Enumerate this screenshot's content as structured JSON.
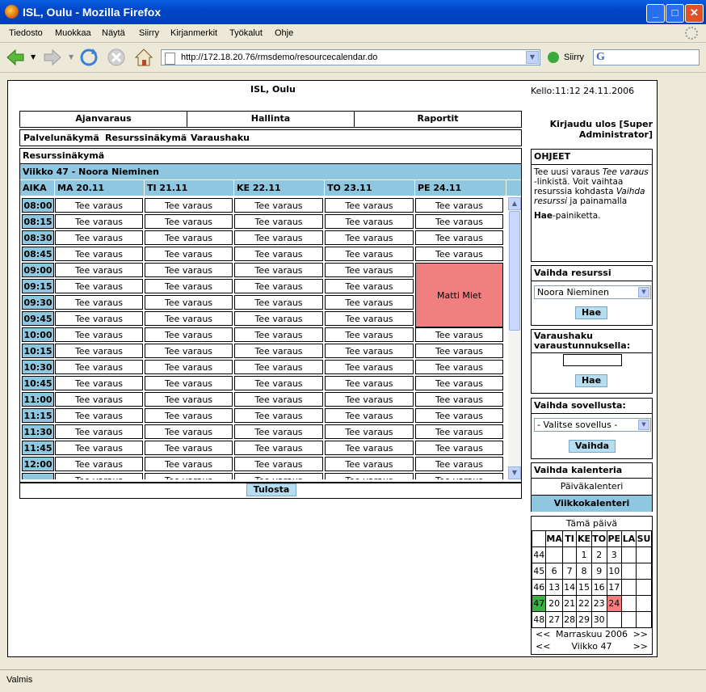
{
  "window": {
    "title": "ISL, Oulu - Mozilla Firefox"
  },
  "menu": [
    "Tiedosto",
    "Muokkaa",
    "Näytä",
    "Siirry",
    "Kirjanmerkit",
    "Työkalut",
    "Ohje"
  ],
  "toolbar": {
    "url": "http://172.18.20.76/rmsdemo/resourcecalendar.do",
    "go_label": "Siirry"
  },
  "header": {
    "org": "ISL, Oulu",
    "clock": "Kello:11:12 24.11.2006"
  },
  "main_menu": [
    "Ajanvaraus",
    "Hallinta",
    "Raportit"
  ],
  "sub_menu": [
    "Palvelunäkymä",
    "Resurssinäkymä",
    "Varaushaku"
  ],
  "calendar": {
    "section_title": "Resurssinäkymä",
    "week_title": "Viikko 47 - Noora Nieminen",
    "time_header": "AIKA",
    "days": [
      "MA 20.11",
      "TI 21.11",
      "KE 22.11",
      "TO 23.11",
      "PE 24.11"
    ],
    "times": [
      "08:00",
      "08:15",
      "08:30",
      "08:45",
      "09:00",
      "09:15",
      "09:30",
      "09:45",
      "10:00",
      "10:15",
      "10:30",
      "10:45",
      "11:00",
      "11:15",
      "11:30",
      "11:45",
      "12:00"
    ],
    "slot_label": "Tee varaus",
    "booking": {
      "label": "Matti Miet",
      "day": "PE 24.11",
      "start": "09:00",
      "end": "10:00"
    },
    "print_label": "Tulosta"
  },
  "sidebar": {
    "logout": "Kirjaudu ulos [Super Administrator]",
    "help_title": "OHJEET",
    "help_text": {
      "p1": "Tee uusi varaus ",
      "p1_em": "Tee varaus",
      "p2": " -linkistä. Voit vaihtaa resurssia kohdasta ",
      "p2_em": "Vaihda resurssi",
      "p3": " ja painamalla",
      "p4_bold": "Hae",
      "p4": "-painiketta."
    },
    "resource": {
      "title": "Vaihda resurssi",
      "selected": "Noora Nieminen",
      "button": "Hae"
    },
    "search": {
      "title": "Varaushaku varaustunnuksella:",
      "value": "",
      "button": "Hae"
    },
    "app": {
      "title": "Vaihda sovellusta:",
      "selected": "- Valitse sovellus -",
      "button": "Vaihda"
    },
    "calendar_switch": {
      "title": "Vaihda kalenteria",
      "day": "Päiväkalenteri",
      "week": "Viikkokalenteri"
    },
    "mini_calendar": {
      "today_label": "Tämä päivä",
      "weekdays": [
        "MA",
        "TI",
        "KE",
        "TO",
        "PE",
        "LA",
        "SU"
      ],
      "weeks": [
        {
          "wk": "44",
          "days": [
            "",
            "",
            "1",
            "2",
            "3",
            "",
            ""
          ]
        },
        {
          "wk": "45",
          "days": [
            "6",
            "7",
            "8",
            "9",
            "10",
            "",
            ""
          ]
        },
        {
          "wk": "46",
          "days": [
            "13",
            "14",
            "15",
            "16",
            "17",
            "",
            ""
          ]
        },
        {
          "wk": "47",
          "days": [
            "20",
            "21",
            "22",
            "23",
            "24",
            "",
            ""
          ]
        },
        {
          "wk": "48",
          "days": [
            "27",
            "28",
            "29",
            "30",
            "",
            "",
            ""
          ]
        }
      ],
      "current_week": "47",
      "selected_day": "24",
      "month_nav": {
        "prev": "<<",
        "label": "Marraskuu 2006",
        "next": ">>"
      },
      "week_nav": {
        "prev": "<<",
        "label": "Viikko 47",
        "next": ">>"
      }
    }
  },
  "status": "Valmis"
}
